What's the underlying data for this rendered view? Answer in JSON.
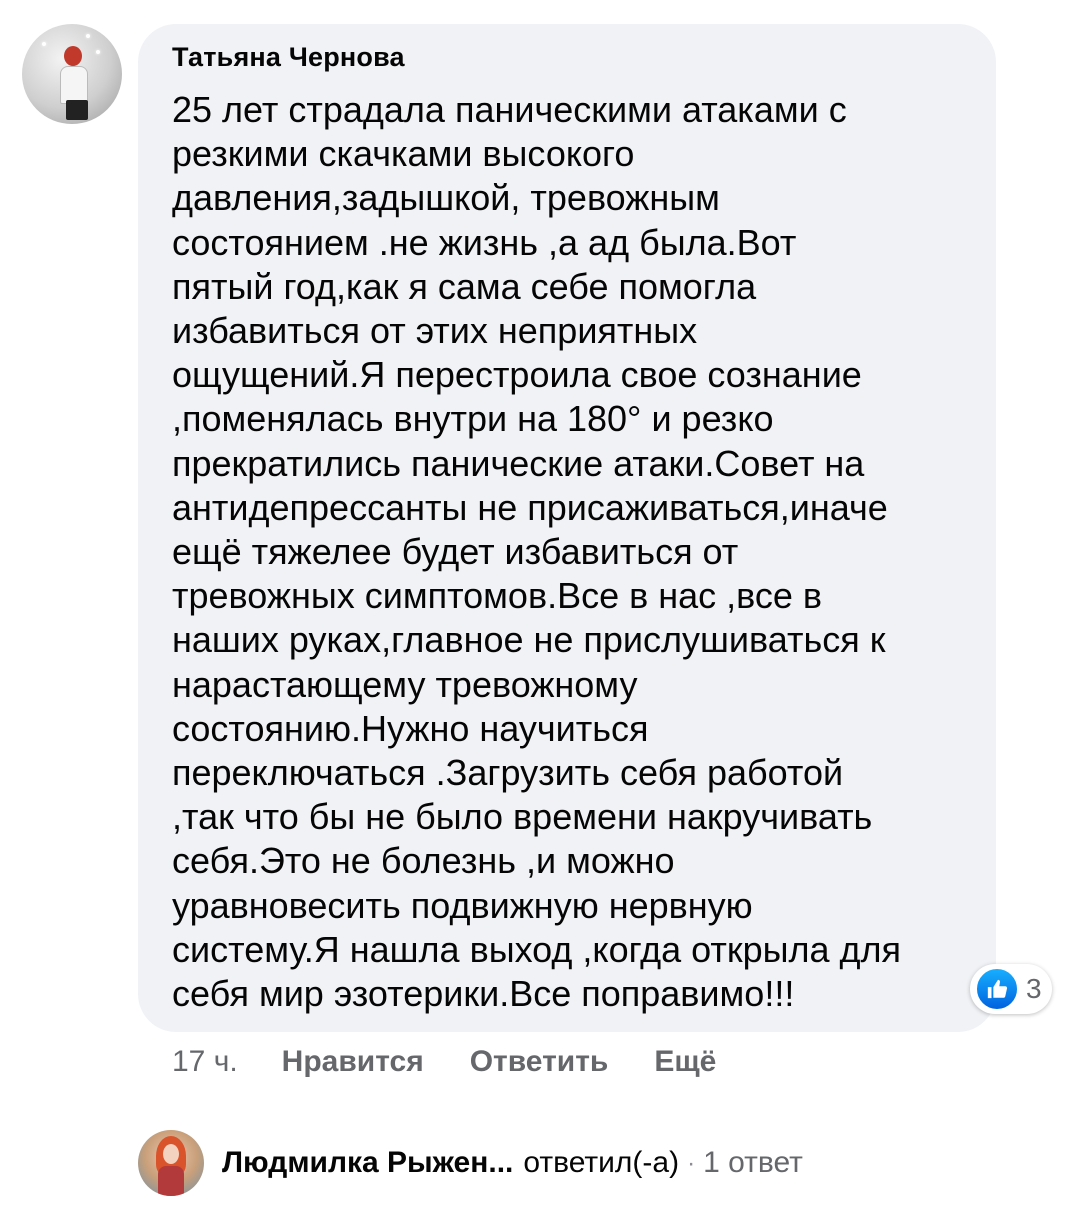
{
  "comment": {
    "author": "Татьяна Чернова",
    "lines": [
      "25 лет страдала паническими атаками с",
      "резкими скачками высокого",
      "давления,задышкой, тревожным",
      "состоянием .не жизнь ,а ад была.Вот",
      "пятый год,как я сама себе помогла",
      "избавиться от этих неприятных",
      "ощущений.Я перестроила свое сознание",
      ",поменялась внутри на 180° и резко",
      "прекратились панические атаки.Совет на",
      "антидепрессанты не присаживаться,иначе",
      "ещё тяжелее будет избавиться от",
      "тревожных симптомов.Все в нас ,все в",
      "наших руках,главное не прислушиваться к",
      "нарастающему тревожному",
      "состоянию.Нужно научиться",
      "переключаться .Загрузить себя работой",
      ",так что бы не было времени накручивать",
      "себя.Это не болезнь ,и можно",
      "уравновесить подвижную нервную",
      "систему.Я нашла выход ,когда открыла для",
      "себя мир эзотерики.Все поправимо!!!"
    ],
    "reaction_count": "3",
    "reaction_icon": "like-icon",
    "time": "17 ч.",
    "like_label": "Нравится",
    "reply_label": "Ответить",
    "more_label": "Ещё"
  },
  "reply_summary": {
    "name": "Людмилка Рыжен...",
    "verb": "ответил(-а)",
    "separator": "·",
    "count": "1 ответ"
  },
  "colors": {
    "bubble": "#f0f2f5",
    "text": "#050505",
    "secondary": "#65676b",
    "like_blue": "#1877f2"
  }
}
